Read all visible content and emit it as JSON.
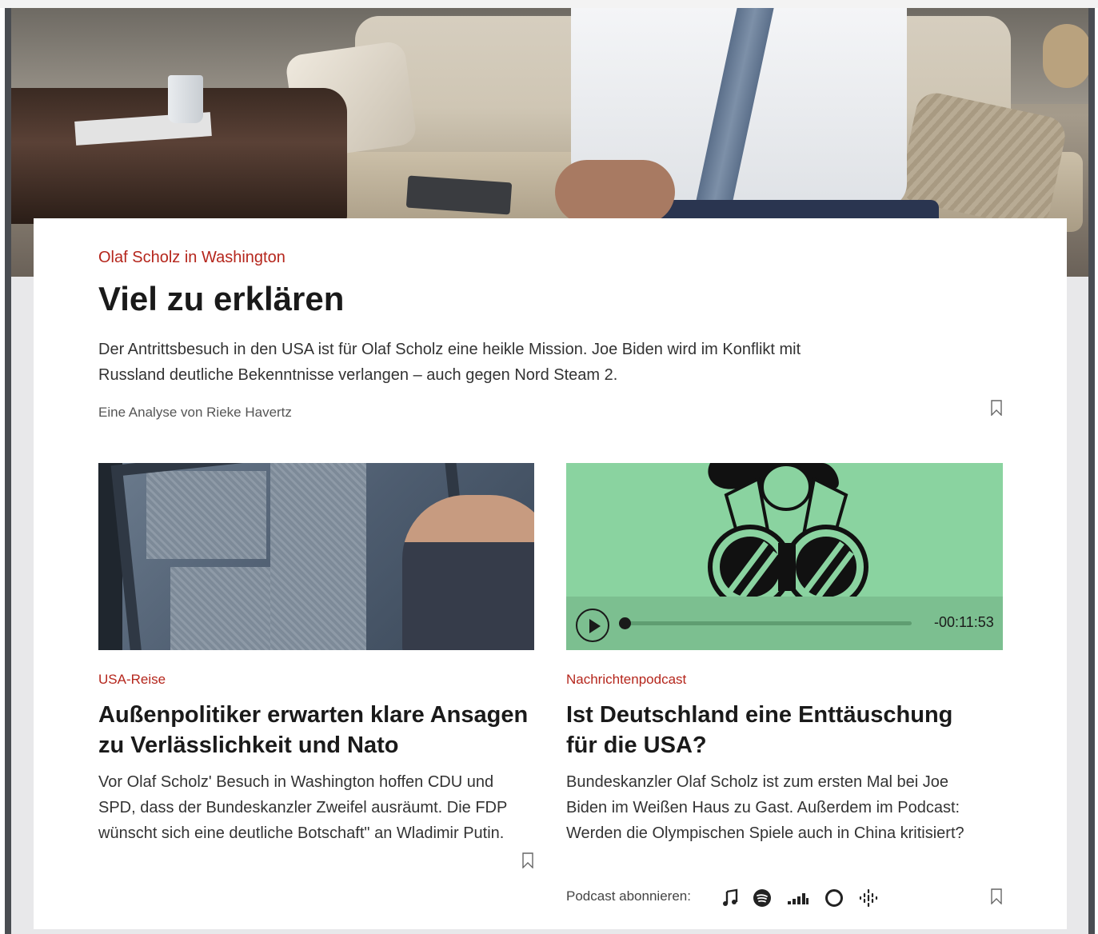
{
  "hero": {
    "image_alt": "Olaf Scholz sitting on sofa in aircraft cabin",
    "kicker": "Olaf Scholz in Washington",
    "title": "Viel zu erklären",
    "lead": "Der Antrittsbesuch in den USA ist für Olaf Scholz eine heikle Mission. Joe Biden wird im Konflikt mit Russland deutliche Bekenntnisse verlangen – auch gegen Nord Steam 2.",
    "byline": "Eine Analyse von Rieke Havertz"
  },
  "articles": [
    {
      "kicker": "USA-Reise",
      "title": "Außenpolitiker erwarten klare Ansagen zu Verlässlichkeit und Nato",
      "lead": "Vor Olaf Scholz' Besuch in Washington hoffen CDU und SPD, dass der Bundeskanzler Zweifel ausräumt. Die FDP wünscht sich eine deutliche Botschaft\" an Wladimir Putin."
    },
    {
      "kicker": "Nachrichtenpodcast",
      "title": "Ist Deutschland eine Enttäuschung für die USA?",
      "lead": "Bundeskanzler Olaf Scholz ist zum ersten Mal bei Joe Biden im Weißen Haus zu Gast. Außerdem im Podcast: Werden die Olympischen Spiele auch in China kritisiert?",
      "player": {
        "time": "-00:11:53",
        "progress": 0.0
      },
      "subscribe_label": "Podcast abonnieren:",
      "podcast_icons": [
        "apple-podcasts-icon",
        "spotify-icon",
        "deezer-icon",
        "podcast-addict-icon",
        "google-podcasts-icon"
      ]
    }
  ],
  "colors": {
    "accent": "#b5261c",
    "podcast_bg": "#8ad3a0",
    "frame": "#4a4d52",
    "page_bg": "#e8e8ea"
  }
}
